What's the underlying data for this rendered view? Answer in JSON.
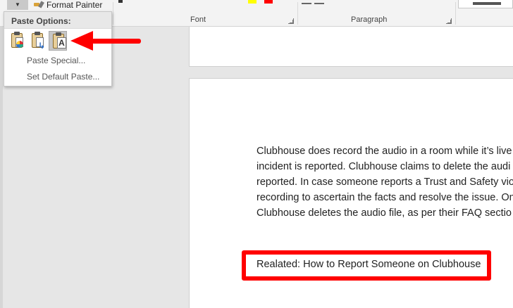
{
  "ribbon": {
    "format_painter": "Format Painter",
    "font_group": "Font",
    "paragraph_group": "Paragraph"
  },
  "paste_menu": {
    "header": "Paste Options:",
    "options": [
      {
        "icon": "keep-source-formatting-icon"
      },
      {
        "icon": "merge-formatting-icon"
      },
      {
        "icon": "keep-text-only-icon",
        "selected": true
      }
    ],
    "paste_special": "Paste Special...",
    "set_default_paste": "Set Default Paste..."
  },
  "document": {
    "paragraph_lines": [
      "Clubhouse does record the audio in a room while it’s live",
      "incident is reported. Clubhouse claims to delete the audi",
      "reported. In case someone reports a Trust and Safety vio",
      "recording to ascertain the facts and resolve the issue. On",
      "Clubhouse deletes the audio file, as per their FAQ sectio"
    ],
    "related_line": "Realated: How to Report Someone on Clubhouse"
  },
  "annotation_color": "#ff0000"
}
